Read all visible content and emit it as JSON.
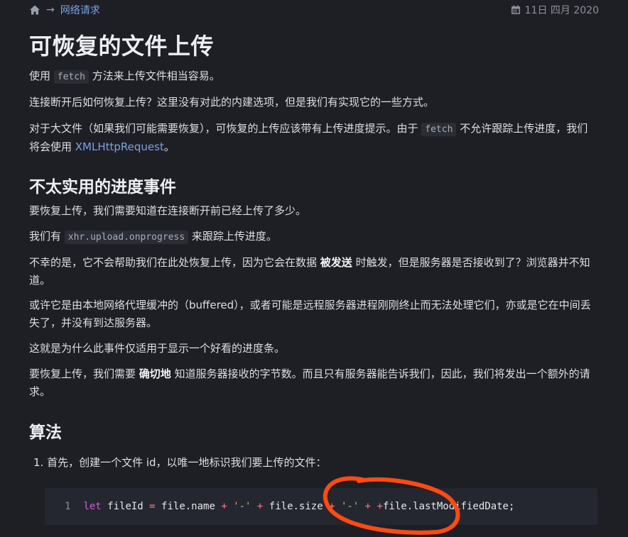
{
  "breadcrumb": {
    "arrow": "→",
    "link": "网络请求",
    "date": "11日 四月 2020"
  },
  "title": "可恢复的文件上传",
  "intro": {
    "p1_before": "使用 ",
    "p1_code": "fetch",
    "p1_after": " 方法来上传文件相当容易。",
    "p2": "连接断开后如何恢复上传？这里没有对此的内建选项，但是我们有实现它的一些方式。",
    "p3_before": "对于大文件（如果我们可能需要恢复），可恢复的上传应该带有上传进度提示。由于 ",
    "p3_code": "fetch",
    "p3_mid": " 不允许跟踪上传进度，我们将会使用 ",
    "p3_link": "XMLHttpRequest",
    "p3_after": "。"
  },
  "section1": {
    "heading": "不太实用的进度事件",
    "p1": "要恢复上传，我们需要知道在连接断开前已经上传了多少。",
    "p2_before": "我们有 ",
    "p2_code": "xhr.upload.onprogress",
    "p2_after": " 来跟踪上传进度。",
    "p3_before": "不幸的是，它不会帮助我们在此处恢复上传，因为它会在数据 ",
    "p3_bold": "被发送",
    "p3_after": " 时触发，但是服务器是否接收到了？浏览器并不知道。",
    "p4": "或许它是由本地网络代理缓冲的（buffered），或者可能是远程服务器进程刚刚终止而无法处理它们，亦或是它在中间丢失了，并没有到达服务器。",
    "p5": "这就是为什么此事件仅适用于显示一个好看的进度条。",
    "p6_before": "要恢复上传，我们需要 ",
    "p6_bold": "确切地",
    "p6_after": " 知道服务器接收的字节数。而且只有服务器能告诉我们，因此，我们将发出一个额外的请求。"
  },
  "section2": {
    "heading": "算法",
    "step1": "1. 首先，创建一个文件 id，以唯一地标识我们要上传的文件："
  },
  "code": {
    "line_no": "1",
    "kw": "let",
    "var": " fileId ",
    "eq": "=",
    "t1": " file.name ",
    "plus1": "+",
    "s1": " '-' ",
    "plus2": "+",
    "t2": " file.size ",
    "plus3": "+",
    "s2": " '-' ",
    "plus4": "+",
    "t3": " ",
    "plus5": "+",
    "t4": "file.lastModifiedDate;"
  },
  "colors": {
    "annotation": "#ff4a12",
    "link": "#7aa2e8",
    "background": "#1e1f25"
  },
  "icons": {
    "home": "home-icon",
    "calendar": "calendar-icon"
  }
}
